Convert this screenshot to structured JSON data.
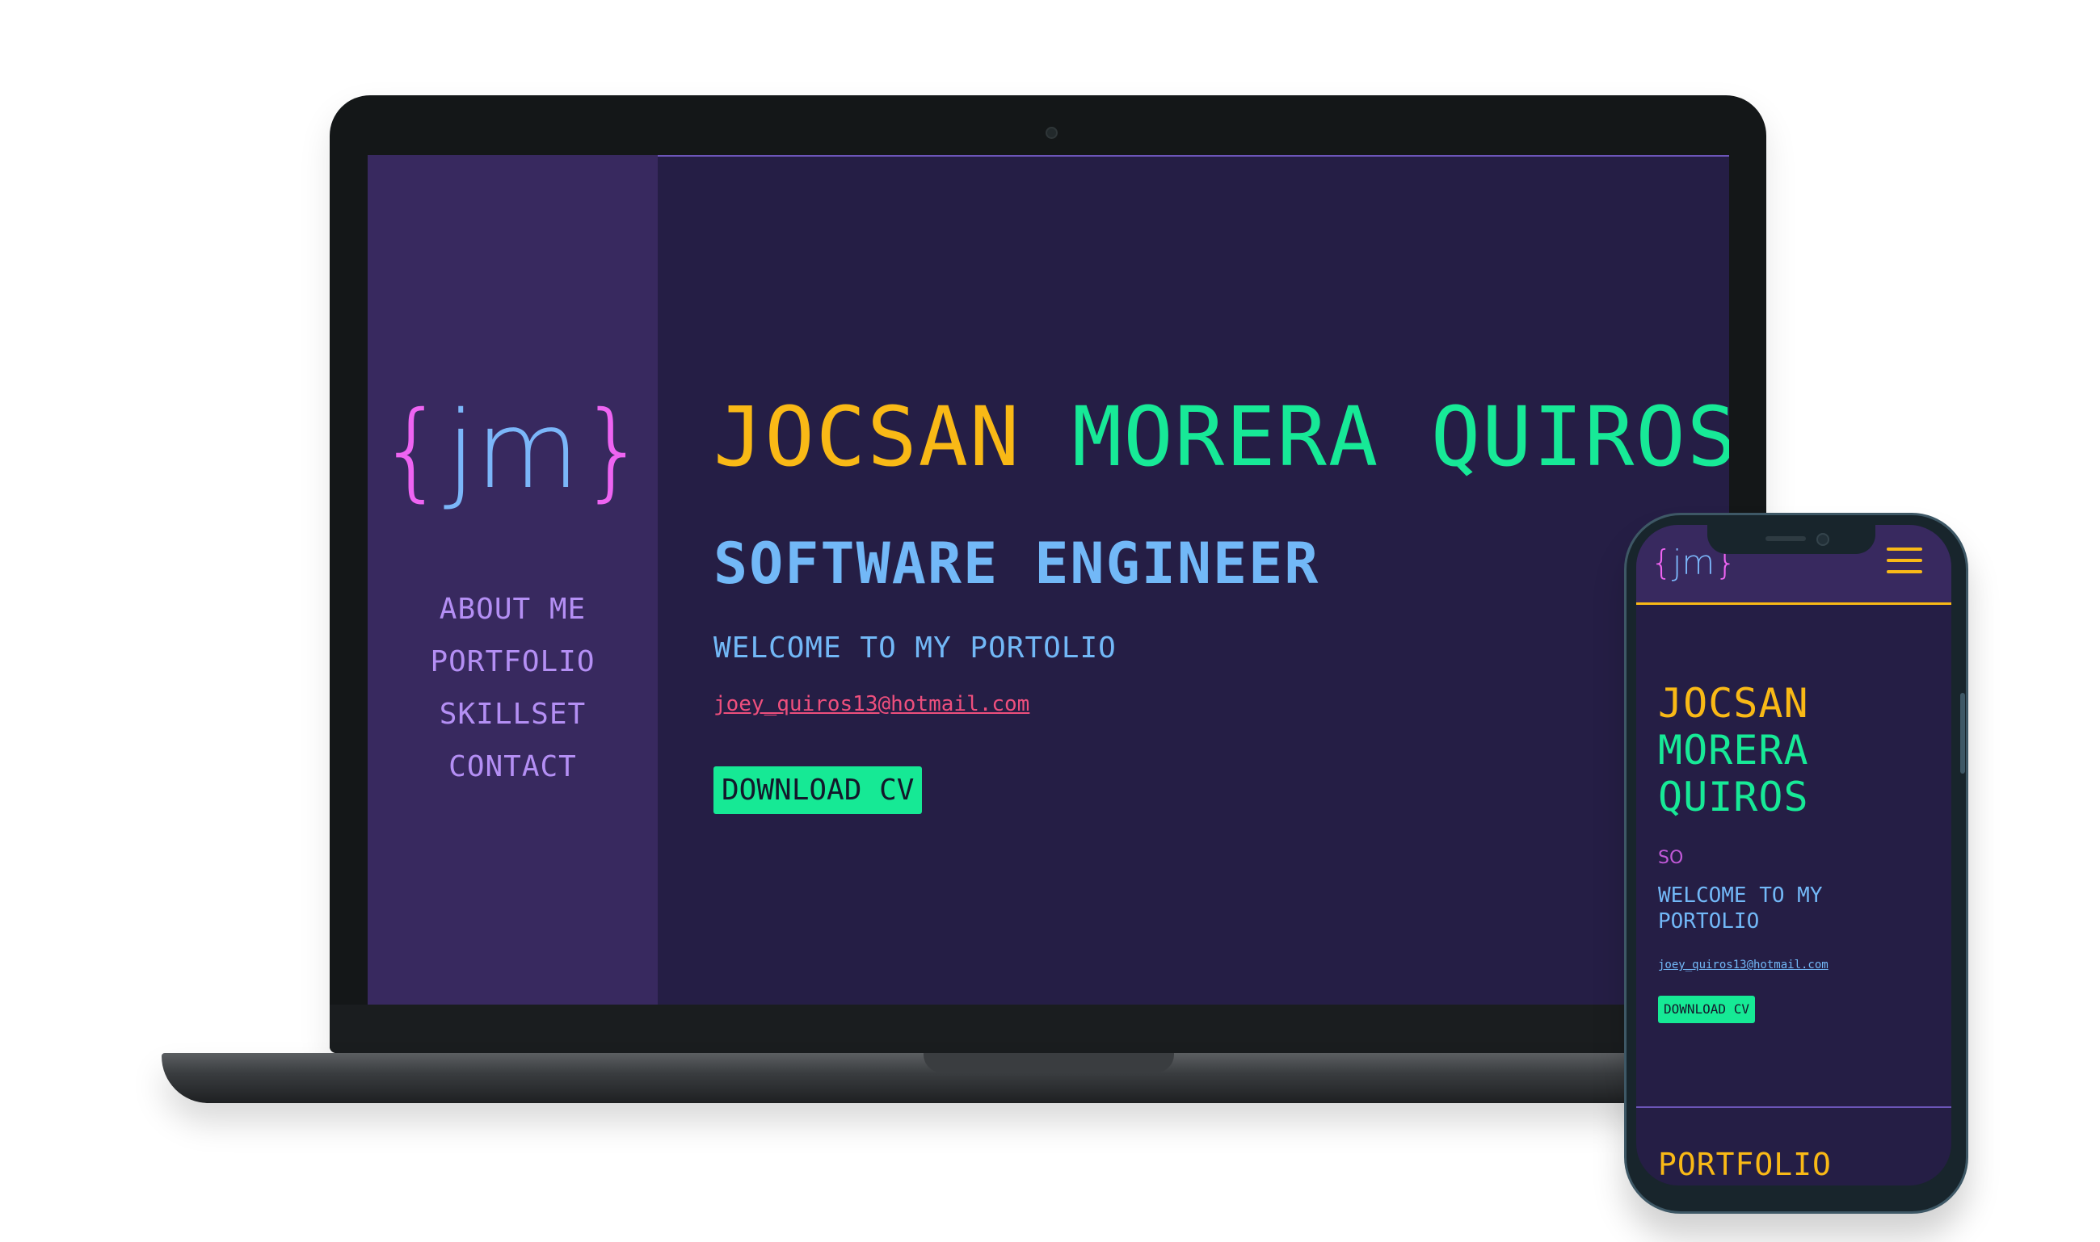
{
  "colors": {
    "background": "#ffffff",
    "screen_bg": "#251e45",
    "sidebar_bg": "#38295f",
    "accent_yellow": "#f9b916",
    "accent_green": "#17e997",
    "accent_blue": "#72b8f7",
    "accent_purple": "#b48ff4",
    "accent_pink": "#ee64f2",
    "email_red": "#ee4f7d"
  },
  "laptop": {
    "logo": {
      "open": "{",
      "text": "jm",
      "close": "}"
    },
    "nav": [
      {
        "label": "ABOUT ME"
      },
      {
        "label": "PORTFOLIO"
      },
      {
        "label": "SKILLSET"
      },
      {
        "label": "CONTACT"
      }
    ],
    "hero": {
      "first_name": "JOCSAN",
      "last_name": "MORERA QUIROS",
      "title": "SOFTWARE ENGINEER",
      "welcome": "WELCOME TO MY PORTOLIO",
      "email": "joey_quiros13@hotmail.com",
      "cv_button": "DOWNLOAD CV"
    }
  },
  "phone": {
    "logo": {
      "open": "{",
      "text": "jm",
      "close": "}"
    },
    "menu_icon": "hamburger-icon",
    "hero": {
      "name_line1": "JOCSAN",
      "name_line2": "MORERA",
      "name_line3": "QUIROS",
      "subtitle": "SO",
      "welcome": "WELCOME TO MY PORTOLIO",
      "email": "joey_quiros13@hotmail.com",
      "cv_button": "DOWNLOAD CV"
    },
    "section_title": "PORTFOLIO"
  }
}
